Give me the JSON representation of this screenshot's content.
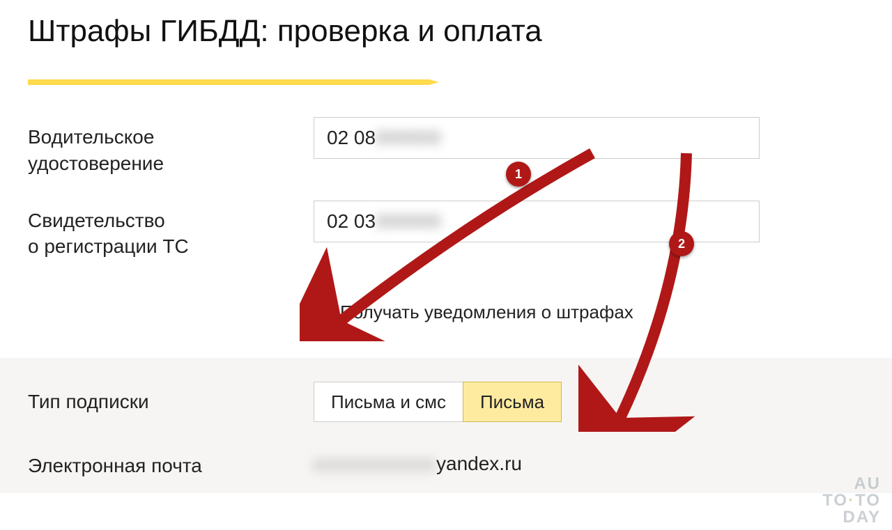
{
  "title": "Штрафы ГИБДД: проверка и оплата",
  "fields": {
    "license": {
      "label": "Водительское\nудостоверение",
      "value_visible": "02 08 ",
      "value_hidden": "000000"
    },
    "registration": {
      "label": "Свидетельство\nо регистрации ТС",
      "value_visible": "02 03 ",
      "value_hidden": "000000"
    }
  },
  "checkbox": {
    "checked": true,
    "label": "Получать уведомления о штрафах"
  },
  "subscription": {
    "label": "Тип подписки",
    "options": [
      "Письма и смс",
      "Письма"
    ],
    "selected": 1
  },
  "email": {
    "label": "Электронная почта",
    "hidden_part": "xxxxxxxxxxx",
    "visible_part": "yandex.ru"
  },
  "annotations": {
    "badge1": "1",
    "badge2": "2"
  },
  "watermark": {
    "l1": "AU",
    "l2_a": "TO",
    "l2_dot": "·",
    "l2_b": "TO",
    "l3": "DAY"
  }
}
